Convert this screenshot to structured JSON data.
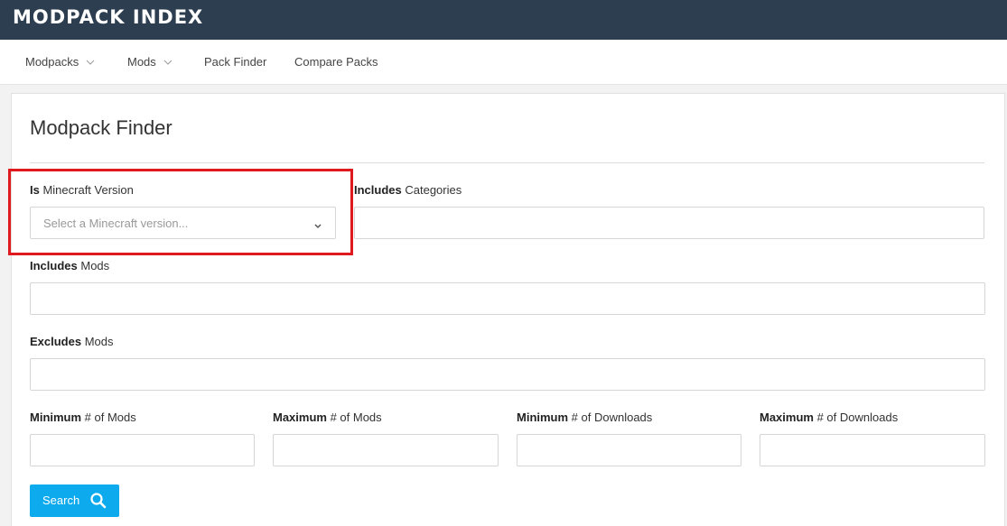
{
  "header": {
    "brand": "MODPACK INDEX",
    "bg_color": "#2c3e50"
  },
  "nav": {
    "items": [
      {
        "label": "Modpacks",
        "has_dropdown": true
      },
      {
        "label": "Mods",
        "has_dropdown": true
      },
      {
        "label": "Pack Finder",
        "has_dropdown": false
      },
      {
        "label": "Compare Packs",
        "has_dropdown": false
      }
    ]
  },
  "finder": {
    "title": "Modpack Finder",
    "minecraft_version": {
      "prefix": "Is",
      "label": " Minecraft Version",
      "placeholder": "Select a Minecraft version..."
    },
    "categories": {
      "prefix": "Includes",
      "label": " Categories",
      "value": ""
    },
    "includes_mods": {
      "prefix": "Includes",
      "label": " Mods",
      "value": ""
    },
    "excludes_mods": {
      "prefix": "Excludes",
      "label": " Mods",
      "value": ""
    },
    "min_mods": {
      "prefix": "Minimum",
      "label": " # of Mods",
      "value": ""
    },
    "max_mods": {
      "prefix": "Maximum",
      "label": " # of Mods",
      "value": ""
    },
    "min_downloads": {
      "prefix": "Minimum",
      "label": " # of Downloads",
      "value": ""
    },
    "max_downloads": {
      "prefix": "Maximum",
      "label": " # of Downloads",
      "value": ""
    },
    "search_button": "Search",
    "accent_color": "#0eaaee",
    "highlight_color": "#e0191e"
  }
}
